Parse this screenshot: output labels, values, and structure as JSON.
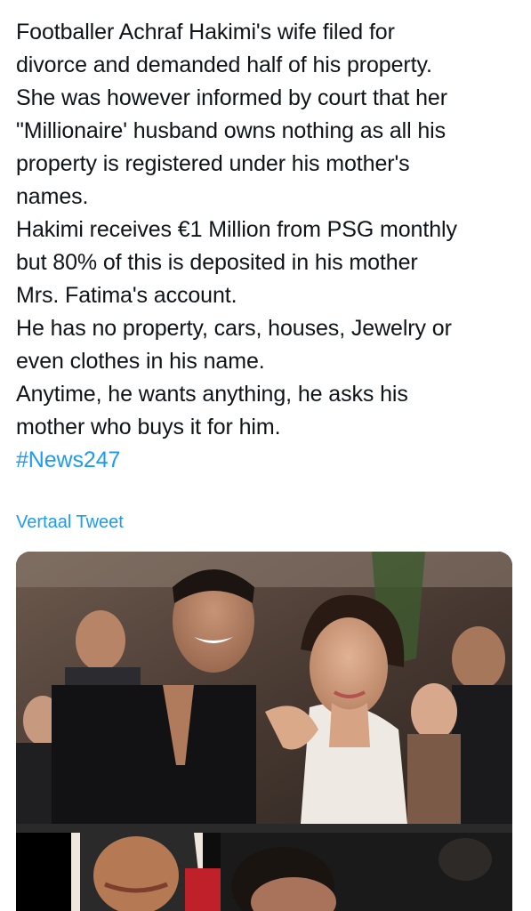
{
  "tweet": {
    "lines": [
      "Footballer Achraf Hakimi's wife filed for",
      "divorce and demanded half of his property.",
      "She was however informed by court that her",
      "\"Millionaire' husband owns nothing as all his",
      "property is registered under his mother's",
      "names.",
      "Hakimi receives €1 Million from PSG monthly",
      "but 80% of this is deposited in his mother",
      "Mrs. Fatima's account.",
      "He has no property, cars, houses, Jewelry or",
      "even clothes in his name.",
      "Anytime, he wants anything, he asks his",
      "mother who buys it for him."
    ],
    "hashtag": "#News247",
    "translate_label": "Vertaal Tweet"
  },
  "media": {
    "icons": [
      "couple-photo",
      "woman-photo"
    ]
  },
  "colors": {
    "text": "#0f1419",
    "link": "#1d9bf0",
    "background": "#ffffff"
  }
}
